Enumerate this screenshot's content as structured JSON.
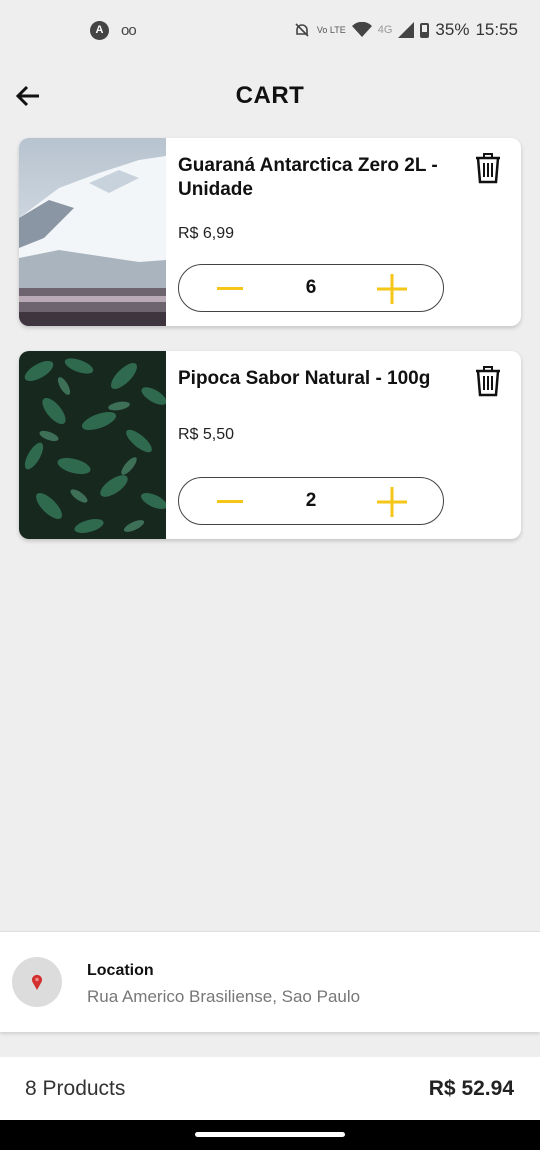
{
  "status_bar": {
    "time": "15:55",
    "battery": "35%",
    "volte_label": "Vo LTE",
    "network_label": "4G",
    "icons": [
      "a-icon",
      "voicemail-icon",
      "mute-icon",
      "volte-icon",
      "wifi-icon",
      "signal-icon",
      "battery-icon"
    ]
  },
  "header": {
    "title": "CART",
    "back_icon": "arrow-left-icon"
  },
  "cart": {
    "items": [
      {
        "name": "Guaraná Antarctica Zero 2L - Unidade",
        "price": "R$ 6,99",
        "quantity": "6",
        "image": "snowy-mountain-photo"
      },
      {
        "name": "Pipoca Sabor Natural - 100g",
        "price": "R$ 5,50",
        "quantity": "2",
        "image": "green-leaves-photo"
      }
    ]
  },
  "location": {
    "title": "Location",
    "address": "Rua Americo Brasiliense, Sao Paulo",
    "icon": "map-pin-icon"
  },
  "summary": {
    "products": "8 Products",
    "total": "R$ 52.94"
  },
  "colors": {
    "accent": "#f5c518",
    "background": "#eeeeee",
    "card": "#ffffff",
    "pin": "#d32f2f"
  }
}
